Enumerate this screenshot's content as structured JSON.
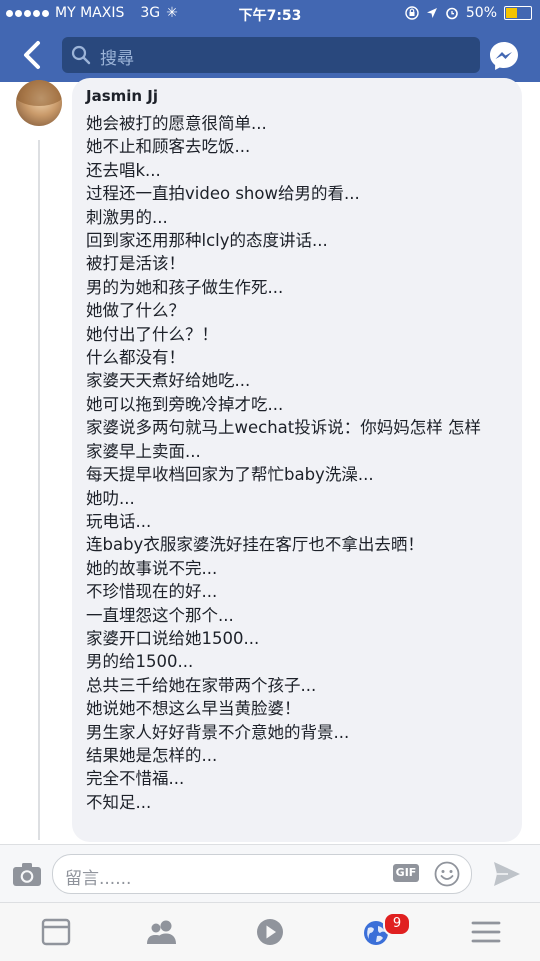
{
  "status_bar": {
    "carrier": "MY MAXIS",
    "network": "3G",
    "time": "下午7:53",
    "battery": "50%",
    "battery_level": 0.5
  },
  "nav": {
    "search_placeholder": "搜尋",
    "back_icon": "chevron-left-icon",
    "messenger_icon": "messenger-icon"
  },
  "comment": {
    "author": "Jasmin Jj",
    "lines": [
      "她会被打的愿意很简单...",
      "她不止和顾客去吃饭...",
      "还去唱k...",
      "过程还一直拍video show给男的看...",
      "刺激男的...",
      "回到家还用那种lcly的态度讲话...",
      "被打是活该！",
      "男的为她和孩子做生作死...",
      "她做了什么？",
      "她付出了什么？！",
      "什么都没有！",
      "家婆天天煮好给她吃...",
      "她可以拖到旁晚冷掉才吃...",
      "家婆说多两句就马上wechat投诉说：你妈妈怎样 怎样",
      "家婆早上卖面...",
      "每天提早收档回家为了帮忙baby洗澡...",
      "她叻...",
      "玩电话...",
      "连baby衣服家婆洗好挂在客厅也不拿出去晒！",
      "她的故事说不完...",
      "不珍惜现在的好...",
      "一直埋怨这个那个...",
      "家婆开口说给她1500...",
      "男的给1500...",
      "总共三千给她在家带两个孩子...",
      "她说她不想这么早当黄脸婆！",
      "男生家人好好背景不介意她的背景...",
      "结果她是怎样的...",
      "完全不惜福...",
      "不知足..."
    ]
  },
  "composer": {
    "placeholder": "留言......",
    "gif_label": "GIF"
  },
  "tabbar": {
    "items": [
      "news-feed-icon",
      "friends-icon",
      "video-icon",
      "notifications-globe-icon",
      "menu-icon"
    ],
    "notification_count": "9"
  },
  "colors": {
    "header": "#4267b2",
    "search_box": "#29487d",
    "bubble": "#f1f2f6",
    "badge": "#e02020"
  }
}
